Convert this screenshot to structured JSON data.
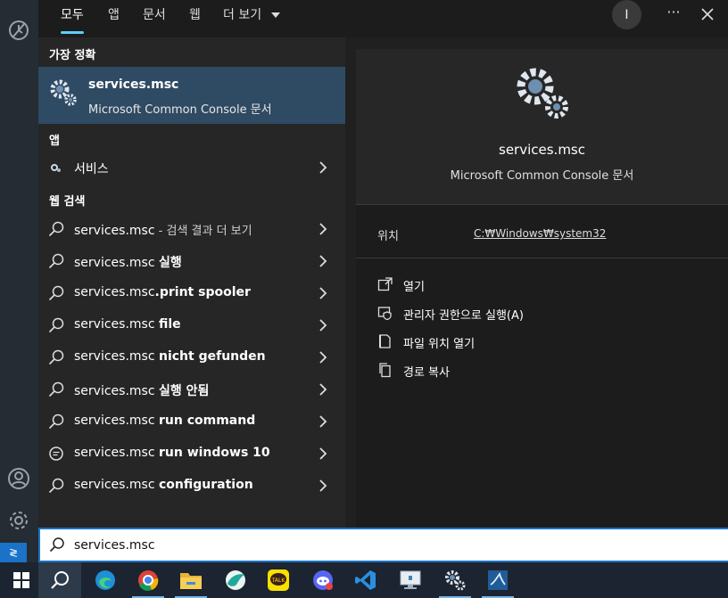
{
  "tabs": {
    "all": "모두",
    "apps": "앱",
    "documents": "문서",
    "web": "웹",
    "more": "더 보기"
  },
  "account_initial": "I",
  "more_options": "···",
  "best_match": {
    "header": "가장 정확",
    "title": "services.msc",
    "subtitle": "Microsoft Common Console 문서"
  },
  "apps_section": {
    "header": "앱",
    "items": [
      {
        "label": "서비스"
      }
    ]
  },
  "web_section": {
    "header": "웹 검색",
    "items": [
      {
        "prefix": "services.msc",
        "suffix": " - 검색 결과 더 보기",
        "icon": "search-icon"
      },
      {
        "prefix": "services.msc ",
        "suffix": "실행",
        "icon": "search-icon"
      },
      {
        "prefix": "services.msc",
        "suffix": ".print spooler",
        "icon": "search-icon"
      },
      {
        "prefix": "services.msc ",
        "suffix": "file",
        "icon": "search-icon"
      },
      {
        "prefix": "services.msc ",
        "suffix": "nicht gefunden",
        "icon": "search-icon"
      },
      {
        "prefix": "services.msc ",
        "suffix": "실행 안됨",
        "icon": "search-icon"
      },
      {
        "prefix": "services.msc ",
        "suffix": "run command",
        "icon": "search-icon"
      },
      {
        "prefix": "services.msc ",
        "suffix": "run windows 10",
        "icon": "chat-icon"
      },
      {
        "prefix": "services.msc ",
        "suffix": "configuration",
        "icon": "search-icon"
      }
    ]
  },
  "details": {
    "title": "services.msc",
    "subtitle": "Microsoft Common Console 문서",
    "location_label": "위치",
    "location_value": "C:₩Windows₩system32",
    "actions": [
      {
        "label": "열기",
        "icon": "open-icon"
      },
      {
        "label": "관리자 권한으로 실행(A)",
        "icon": "admin-shield-icon"
      },
      {
        "label": "파일 위치 열기",
        "icon": "file-location-icon"
      },
      {
        "label": "경로 복사",
        "icon": "copy-icon"
      }
    ]
  },
  "search": {
    "value": "services.msc"
  },
  "colors": {
    "accent": "#60cdff",
    "selected_bg": "#2f4b63",
    "search_border": "#1a73c8"
  },
  "taskbar_icons": [
    "windows-start-icon",
    "search-icon",
    "edge-icon",
    "chrome-icon",
    "file-explorer-icon",
    "app-icon",
    "kakaotalk-icon",
    "discord-icon",
    "vscode-icon",
    "remote-desktop-icon",
    "services-gear-icon",
    "wireshark-icon"
  ]
}
